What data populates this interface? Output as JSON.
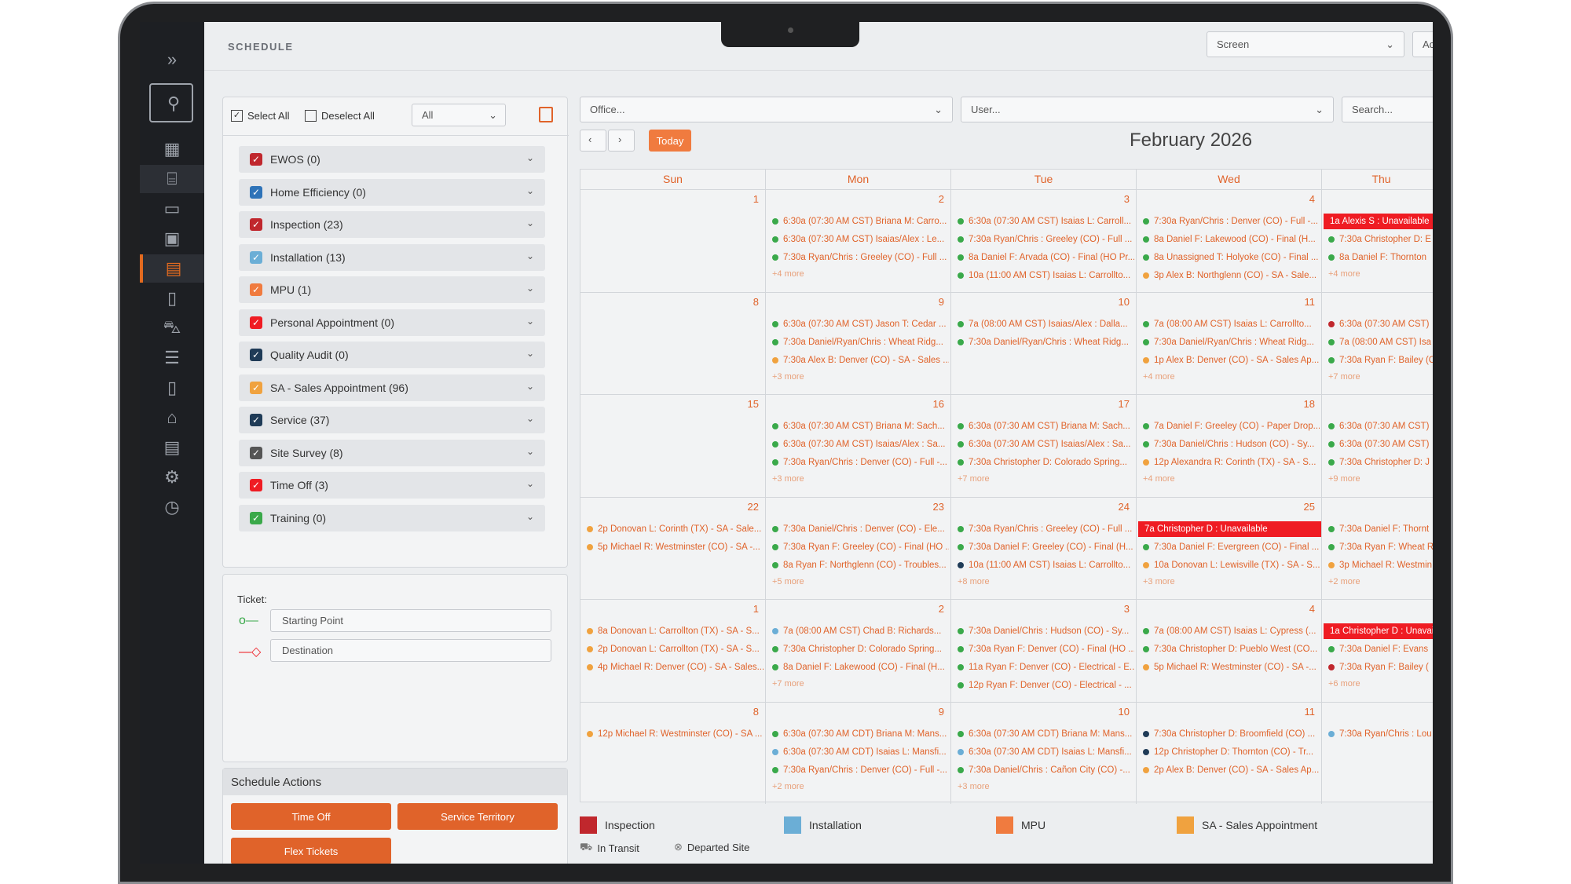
{
  "app": {
    "title": "SCHEDULE",
    "screen_select": "Screen",
    "account": "Acco"
  },
  "filters": {
    "select_all": "Select All",
    "deselect_all": "Deselect All",
    "dropdown": "All"
  },
  "categories": [
    {
      "label": "EWOS (0)",
      "color": "#c0272d"
    },
    {
      "label": "Home Efficiency (0)",
      "color": "#2e73b8"
    },
    {
      "label": "Inspection (23)",
      "color": "#c0272d"
    },
    {
      "label": "Installation (13)",
      "color": "#6baed6"
    },
    {
      "label": "MPU (1)",
      "color": "#f07b3f"
    },
    {
      "label": "Personal Appointment (0)",
      "color": "#ef1c23"
    },
    {
      "label": "Quality Audit (0)",
      "color": "#1f3b57"
    },
    {
      "label": "SA - Sales Appointment (96)",
      "color": "#f0a23f"
    },
    {
      "label": "Service (37)",
      "color": "#1f3b57"
    },
    {
      "label": "Site Survey (8)",
      "color": "#555"
    },
    {
      "label": "Time Off (3)",
      "color": "#ef1c23"
    },
    {
      "label": "Training (0)",
      "color": "#3aa94a"
    }
  ],
  "ticket": {
    "label": "Ticket:",
    "start": "Starting Point",
    "dest": "Destination"
  },
  "actions": {
    "title": "Schedule Actions",
    "time_off": "Time Off",
    "territory": "Service Territory",
    "flex": "Flex Tickets"
  },
  "calendar": {
    "office": "Office...",
    "user": "User...",
    "search": "Search...",
    "today": "Today",
    "month": "February 2026",
    "days": [
      "Sun",
      "Mon",
      "Tue",
      "Wed",
      "Thu"
    ],
    "weeks": [
      [
        {
          "n": "1",
          "ev": []
        },
        {
          "n": "2",
          "ev": [
            [
              "#3aa94a",
              "6:30a (07:30 AM CST) Briana M: Carro..."
            ],
            [
              "#3aa94a",
              "6:30a (07:30 AM CST) Isaias/Alex : Le..."
            ],
            [
              "#3aa94a",
              "7:30a Ryan/Chris : Greeley (CO) - Full ..."
            ]
          ],
          "more": "+4 more"
        },
        {
          "n": "3",
          "ev": [
            [
              "#3aa94a",
              "6:30a (07:30 AM CST) Isaias L: Carroll..."
            ],
            [
              "#3aa94a",
              "7:30a Ryan/Chris : Greeley (CO) - Full ..."
            ],
            [
              "#3aa94a",
              "8a Daniel F: Arvada (CO) - Final (HO Pr..."
            ],
            [
              "#3aa94a",
              "10a (11:00 AM CST) Isaias L: Carrollto..."
            ]
          ]
        },
        {
          "n": "4",
          "ev": [
            [
              "#3aa94a",
              "7:30a Ryan/Chris : Denver (CO) - Full -..."
            ],
            [
              "#3aa94a",
              "8a Daniel F: Lakewood (CO) - Final (H..."
            ],
            [
              "#3aa94a",
              "8a Unassigned T: Holyoke (CO) - Final ..."
            ],
            [
              "#f0a23f",
              "3p Alex B: Northglenn (CO) - SA - Sale..."
            ]
          ]
        },
        {
          "n": "",
          "red": "1a Alexis S : Unavailable",
          "ev": [
            [
              "#3aa94a",
              "7:30a Christopher D: E"
            ],
            [
              "#3aa94a",
              "8a Daniel F: Thornton"
            ]
          ],
          "more": "+4 more"
        }
      ],
      [
        {
          "n": "8",
          "ev": []
        },
        {
          "n": "9",
          "ev": [
            [
              "#3aa94a",
              "6:30a (07:30 AM CST) Jason T: Cedar ..."
            ],
            [
              "#3aa94a",
              "7:30a Daniel/Ryan/Chris : Wheat Ridg..."
            ],
            [
              "#f0a23f",
              "7:30a Alex B: Denver (CO) - SA - Sales ..."
            ]
          ],
          "more": "+3 more"
        },
        {
          "n": "10",
          "ev": [
            [
              "#3aa94a",
              "7a (08:00 AM CST) Isaias/Alex : Dalla..."
            ],
            [
              "#3aa94a",
              "7:30a Daniel/Ryan/Chris : Wheat Ridg..."
            ]
          ]
        },
        {
          "n": "11",
          "ev": [
            [
              "#3aa94a",
              "7a (08:00 AM CST) Isaias L: Carrollto..."
            ],
            [
              "#3aa94a",
              "7:30a Daniel/Ryan/Chris : Wheat Ridg..."
            ],
            [
              "#f0a23f",
              "1p Alex B: Denver (CO) - SA - Sales Ap..."
            ]
          ],
          "more": "+4 more"
        },
        {
          "n": "",
          "ev": [
            [
              "#c0272d",
              "6:30a (07:30 AM CST)"
            ],
            [
              "#3aa94a",
              "7a (08:00 AM CST) Isa"
            ],
            [
              "#3aa94a",
              "7:30a Ryan F: Bailey (C"
            ]
          ],
          "more": "+7 more"
        }
      ],
      [
        {
          "n": "15",
          "ev": []
        },
        {
          "n": "16",
          "ev": [
            [
              "#3aa94a",
              "6:30a (07:30 AM CST) Briana M: Sach..."
            ],
            [
              "#3aa94a",
              "6:30a (07:30 AM CST) Isaias/Alex : Sa..."
            ],
            [
              "#3aa94a",
              "7:30a Ryan/Chris : Denver (CO) - Full -..."
            ]
          ],
          "more": "+3 more"
        },
        {
          "n": "17",
          "ev": [
            [
              "#3aa94a",
              "6:30a (07:30 AM CST) Briana M: Sach..."
            ],
            [
              "#3aa94a",
              "6:30a (07:30 AM CST) Isaias/Alex : Sa..."
            ],
            [
              "#3aa94a",
              "7:30a Christopher D: Colorado Spring..."
            ]
          ],
          "more": "+7 more"
        },
        {
          "n": "18",
          "ev": [
            [
              "#3aa94a",
              "7a Daniel F: Greeley (CO) - Paper Drop..."
            ],
            [
              "#3aa94a",
              "7:30a Daniel/Chris : Hudson (CO) - Sy..."
            ],
            [
              "#f0a23f",
              "12p Alexandra R: Corinth (TX) - SA - S..."
            ]
          ],
          "more": "+4 more"
        },
        {
          "n": "",
          "ev": [
            [
              "#3aa94a",
              "6:30a (07:30 AM CST)"
            ],
            [
              "#3aa94a",
              "6:30a (07:30 AM CST)"
            ],
            [
              "#3aa94a",
              "7:30a Christopher D: J"
            ]
          ],
          "more": "+9 more"
        }
      ],
      [
        {
          "n": "22",
          "ev": [
            [
              "#f0a23f",
              "2p Donovan L: Corinth (TX) - SA - Sale..."
            ],
            [
              "#f0a23f",
              "5p Michael R: Westminster (CO) - SA -..."
            ]
          ]
        },
        {
          "n": "23",
          "ev": [
            [
              "#3aa94a",
              "7:30a Daniel/Chris : Denver (CO) - Ele..."
            ],
            [
              "#3aa94a",
              "7:30a Ryan F: Greeley (CO) - Final (HO ..."
            ],
            [
              "#3aa94a",
              "8a Ryan F: Northglenn (CO) - Troubles..."
            ]
          ],
          "more": "+5 more"
        },
        {
          "n": "24",
          "ev": [
            [
              "#3aa94a",
              "7:30a Ryan/Chris : Greeley (CO) - Full ..."
            ],
            [
              "#3aa94a",
              "7:30a Daniel F: Greeley (CO) - Final (H..."
            ],
            [
              "#1f3b57",
              "10a (11:00 AM CST) Isaias L: Carrollto..."
            ]
          ],
          "more": "+8 more"
        },
        {
          "n": "25",
          "red": "7a Christopher D : Unavailable",
          "ev": [
            [
              "#3aa94a",
              "7:30a Daniel F: Evergreen (CO) - Final ..."
            ],
            [
              "#f0a23f",
              "10a Donovan L: Lewisville (TX) - SA - S..."
            ]
          ],
          "more": "+3 more"
        },
        {
          "n": "",
          "ev": [
            [
              "#3aa94a",
              "7:30a Daniel F: Thornt"
            ],
            [
              "#3aa94a",
              "7:30a Ryan F: Wheat R"
            ],
            [
              "#f0a23f",
              "3p Michael R: Westmin"
            ]
          ],
          "more": "+2 more"
        }
      ],
      [
        {
          "n": "1",
          "ev": [
            [
              "#f0a23f",
              "8a Donovan L: Carrollton (TX) - SA - S..."
            ],
            [
              "#f0a23f",
              "2p Donovan L: Carrollton (TX) - SA - S..."
            ],
            [
              "#f0a23f",
              "4p Michael R: Denver (CO) - SA - Sales..."
            ]
          ]
        },
        {
          "n": "2",
          "ev": [
            [
              "#6baed6",
              "7a (08:00 AM CST) Chad B: Richards..."
            ],
            [
              "#3aa94a",
              "7:30a Christopher D: Colorado Spring..."
            ],
            [
              "#3aa94a",
              "8a Daniel F: Lakewood (CO) - Final (H..."
            ]
          ],
          "more": "+7 more"
        },
        {
          "n": "3",
          "ev": [
            [
              "#3aa94a",
              "7:30a Daniel/Chris : Hudson (CO) - Sy..."
            ],
            [
              "#3aa94a",
              "7:30a Ryan F: Denver (CO) - Final (HO ..."
            ],
            [
              "#3aa94a",
              "11a Ryan F: Denver (CO) - Electrical - E..."
            ],
            [
              "#3aa94a",
              "12p Ryan F: Denver (CO) - Electrical - ..."
            ]
          ]
        },
        {
          "n": "4",
          "ev": [
            [
              "#3aa94a",
              "7a (08:00 AM CST) Isaias L: Cypress (..."
            ],
            [
              "#3aa94a",
              "7:30a Christopher D: Pueblo West (CO..."
            ],
            [
              "#f0a23f",
              "5p Michael R: Westminster (CO) - SA -..."
            ]
          ]
        },
        {
          "n": "",
          "red": "1a Christopher D : Unavai",
          "ev": [
            [
              "#3aa94a",
              "7:30a Daniel F: Evans"
            ],
            [
              "#c0272d",
              "7:30a Ryan F: Bailey ("
            ]
          ],
          "more": "+6 more"
        }
      ],
      [
        {
          "n": "8",
          "ev": [
            [
              "#f0a23f",
              "12p Michael R: Westminster (CO) - SA ..."
            ]
          ]
        },
        {
          "n": "9",
          "ev": [
            [
              "#3aa94a",
              "6:30a (07:30 AM CDT) Briana M: Mans..."
            ],
            [
              "#6baed6",
              "6:30a (07:30 AM CDT) Isaias L: Mansfi..."
            ],
            [
              "#3aa94a",
              "7:30a Ryan/Chris : Denver (CO) - Full -..."
            ]
          ],
          "more": "+2 more"
        },
        {
          "n": "10",
          "ev": [
            [
              "#3aa94a",
              "6:30a (07:30 AM CDT) Briana M: Mans..."
            ],
            [
              "#6baed6",
              "6:30a (07:30 AM CDT) Isaias L: Mansfi..."
            ],
            [
              "#3aa94a",
              "7:30a Daniel/Chris : Cañon City (CO) -..."
            ]
          ],
          "more": "+3 more"
        },
        {
          "n": "11",
          "ev": [
            [
              "#1f3b57",
              "7:30a Christopher D: Broomfield (CO) ..."
            ],
            [
              "#1f3b57",
              "12p Christopher D: Thornton (CO) - Tr..."
            ],
            [
              "#f0a23f",
              "2p Alex B: Denver (CO) - SA - Sales Ap..."
            ]
          ]
        },
        {
          "n": "",
          "ev": [
            [
              "#6baed6",
              "7:30a Ryan/Chris : Lou"
            ]
          ]
        }
      ]
    ]
  },
  "legend": [
    {
      "label": "Inspection",
      "color": "#c0272d"
    },
    {
      "label": "Installation",
      "color": "#6baed6"
    },
    {
      "label": "MPU",
      "color": "#f07b3f"
    },
    {
      "label": "SA - Sales Appointment",
      "color": "#f0a23f"
    }
  ],
  "legend2": {
    "transit": "In Transit",
    "departed": "Departed Site"
  }
}
